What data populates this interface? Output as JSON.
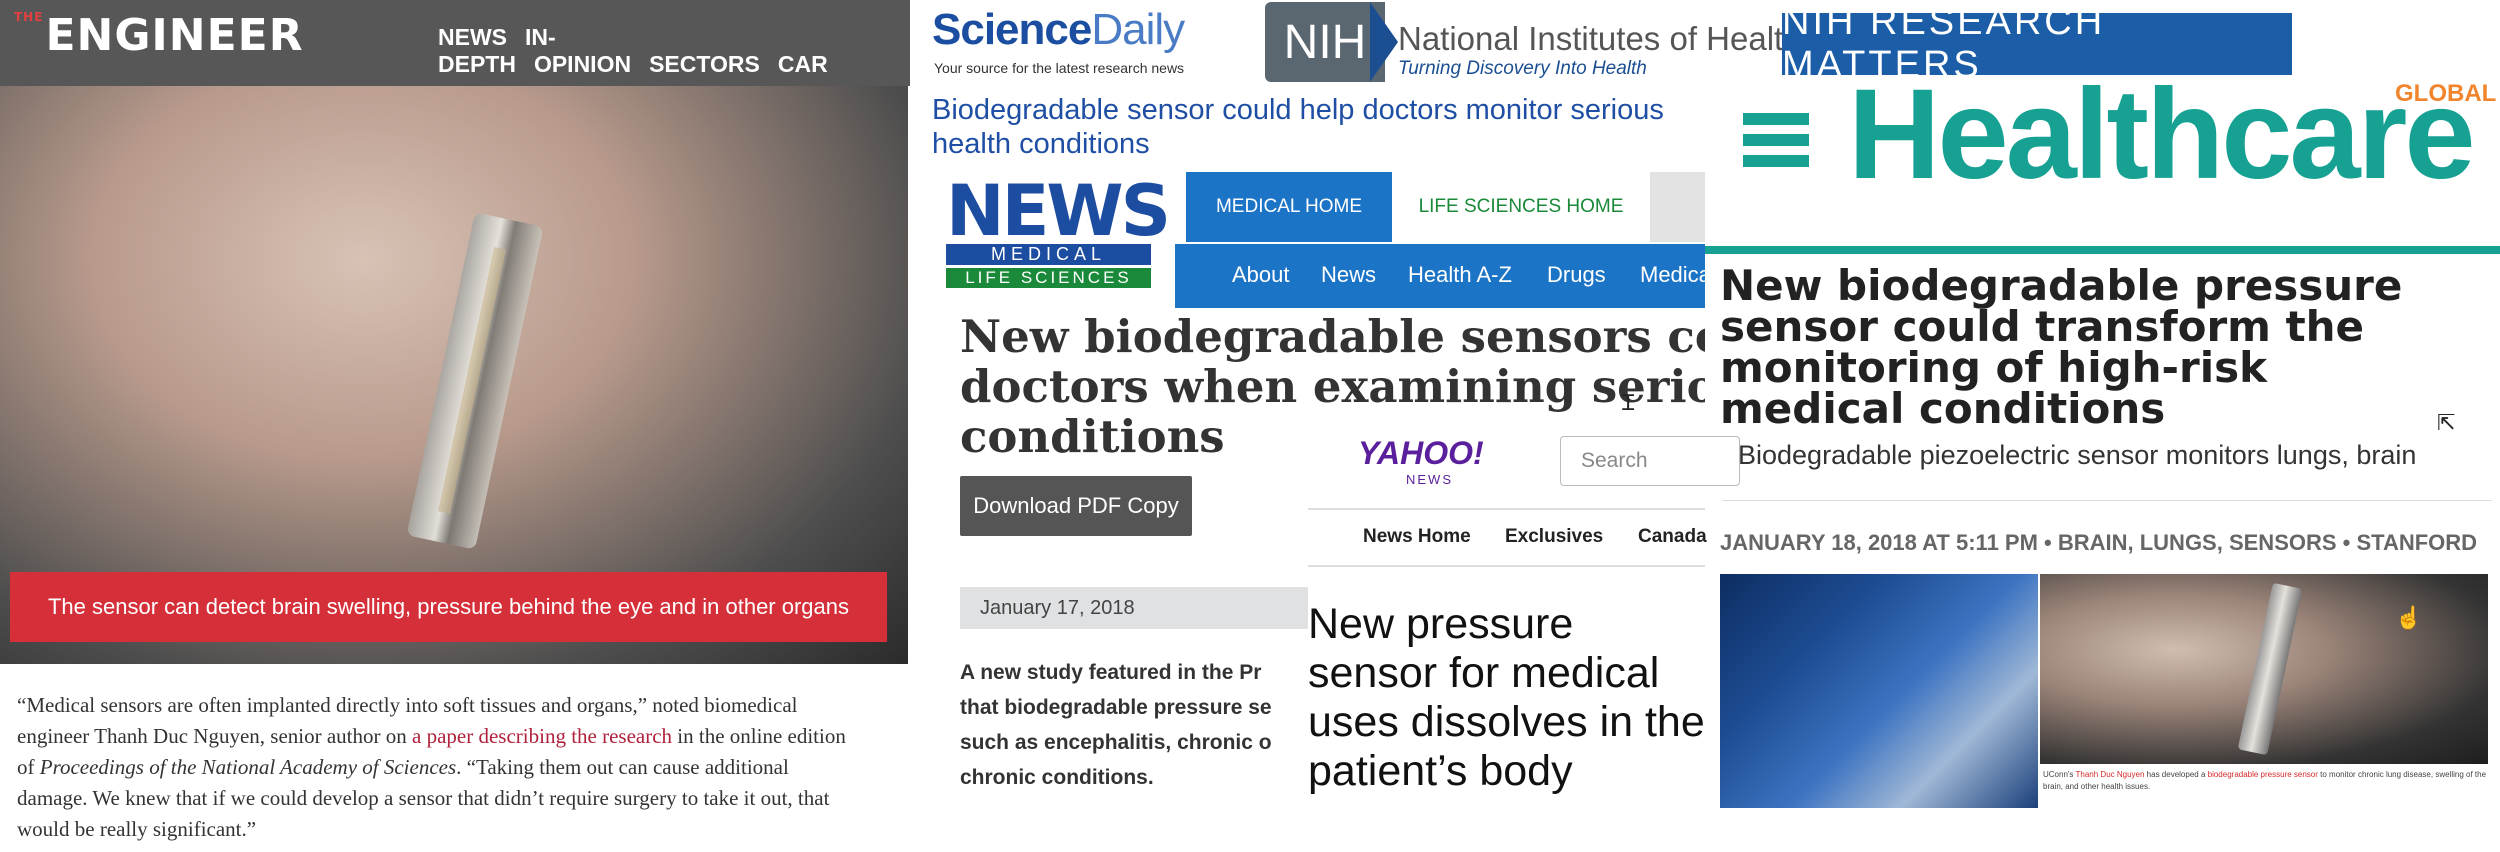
{
  "engineer": {
    "logo_prefix": "THE",
    "logo": "ENGINEER",
    "menu": [
      "NEWS",
      "IN-DEPTH",
      "OPINION",
      "SECTORS",
      "CAR"
    ],
    "caption": "The sensor can detect brain swelling, pressure behind the eye and in other organs",
    "body": {
      "p1": "“Medical sensors are often implanted directly into soft tissues and organs,” noted biomedical engineer Thanh Duc Nguyen, senior author on ",
      "link": "a paper describing the research",
      "p2": " in the online edition of ",
      "journal": "Proceedings of the National Academy of Sciences",
      "p3": ". “Taking them out can cause additional damage. We knew that if we could develop a sensor that didn’t require surgery to take it out, that would be really significant.”"
    }
  },
  "sciencedaily": {
    "logo_science": "Science",
    "logo_daily": "Daily",
    "tagline": "Your source for the latest research news",
    "headline": "Biodegradable sensor could help doctors monitor serious health conditions"
  },
  "nih": {
    "badge": "NIH",
    "name": "National Institutes of Health",
    "tagline": "Turning Discovery Into Health"
  },
  "nih_research_matters": {
    "label": "NIH RESEARCH MATTERS"
  },
  "healthcare_global": {
    "logo": "Healthcare",
    "global": "GLOBAL"
  },
  "news_medical": {
    "logo_news": "NEWS",
    "logo_medical": "MEDICAL",
    "logo_life": "LIFE SCIENCES",
    "tab_medical": "MEDICAL HOME",
    "tab_life": "LIFE SCIENCES HOME",
    "subnav": [
      "About",
      "News",
      "Health A-Z",
      "Drugs",
      "Medica"
    ],
    "headline_lines": [
      "New biodegradable sensors could a",
      "doctors when examining serious he",
      "conditions"
    ],
    "pdf_button": "Download PDF Copy",
    "date": "January 17, 2018",
    "intro_lines": [
      "A new study featured in the Pr",
      "that biodegradable pressure se",
      "such as encephalitis, chronic o",
      "chronic conditions."
    ]
  },
  "yahoo": {
    "logo": "YAHOO!",
    "sub": "NEWS",
    "search_placeholder": "Search",
    "nav": [
      "News Home",
      "Exclusives",
      "Canada"
    ],
    "headline": "New pressure sensor for medical uses dissolves in the patient’s body"
  },
  "healthcare_article": {
    "headline": "New biodegradable pressure sensor could transform the monitoring of high-risk medical conditions",
    "subhead": "Biodegradable piezoelectric sensor monitors lungs, brain",
    "meta": "JANUARY 18, 2018 AT 5:11 PM • BRAIN, LUNGS, SENSORS • STANFORD",
    "image_caption": {
      "a": "UConn's ",
      "name": "Thanh Duc Nguyen",
      "b": " has developed a ",
      "link": "biodegradable pressure sensor",
      "c": " to monitor chronic lung disease, swelling of the brain, and other health issues."
    }
  },
  "icons": {
    "menu": "hamburger-menu-icon",
    "cursor_text": "text-cursor-icon",
    "cursor_arrow": "arrow-cursor-icon",
    "cursor_hand": "hand-cursor-icon"
  },
  "colors": {
    "engineer_nav": "#575757",
    "engineer_caption": "#d5303a",
    "sciencedaily_blue": "#1b4ea0",
    "nih_blue": "#1c4f92",
    "research_matters": "#1c5da8",
    "healthcare_teal": "#16a193",
    "healthcare_orange": "#f0852d",
    "newsmedical_blue": "#1c74c7",
    "newsmedical_green": "#1a8a3a",
    "yahoo_purple": "#5a1f9c"
  }
}
